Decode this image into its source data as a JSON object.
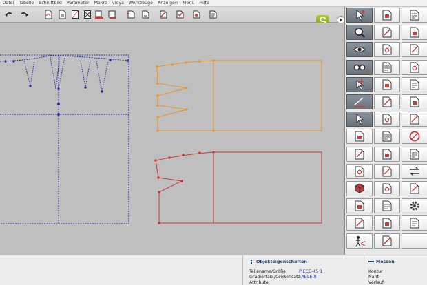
{
  "menu": [
    "Datei",
    "Tabelle",
    "Schnittbild",
    "Parameter",
    "Makro",
    "vidya",
    "Werkzeuge",
    "Anzeigen",
    "Menü",
    "Hilfe"
  ],
  "toolbar": {
    "icons": [
      "undo-icon",
      "redo-icon",
      "open-file-icon",
      "save-file-icon",
      "grade-icon",
      "cut-icon",
      "print-icon",
      "plot-icon",
      "copy-icon",
      "paste-icon",
      "measure-icon",
      "check-icon",
      "settings-icon",
      "export-icon",
      "print-preview-icon",
      "document-icon"
    ]
  },
  "tools": [
    [
      "select-arrow-icon",
      "ruler-pencil-icon",
      "piece-copy-icon"
    ],
    [
      "zoom-icon",
      "sew-icon",
      "piece-layer-icon"
    ],
    [
      "view-eye-icon",
      "piece-grade-icon",
      "piece-multi-icon"
    ],
    [
      "glasses-icon",
      "dart-icon",
      "piece-flip-icon"
    ],
    [
      "pointer-star-icon",
      "book-icon",
      "piece-split-icon"
    ],
    [
      "draw-line-icon",
      "sewing-machine-icon",
      "piece-rotate-icon"
    ],
    [
      "select-piece-icon",
      "piece-cut-icon",
      "piece-fold-icon"
    ],
    [
      "piece-delete-icon",
      "piece-edit-icon",
      "piece-circle-icon"
    ],
    [
      "piece-join-icon",
      "piece-network-icon",
      "piece-sheet-icon"
    ],
    [
      "piece-corner-icon",
      "piece-measure-icon",
      "swap-arrows-icon"
    ],
    [
      "cube-icon",
      "piece-seam-icon",
      "piece-mirror-icon"
    ],
    [
      "piece-list-icon",
      "piece-stack-icon",
      "gear-icon"
    ],
    [
      "piece-view-icon",
      "piece-pin-icon",
      "piece-pattern-icon"
    ],
    [
      "figure-icon",
      "piece-move-icon",
      "blank-tool"
    ]
  ],
  "status": {
    "objekt_header": "Objekteigenschaften",
    "teilename_label": "Teilename/Größe",
    "teilename_value": "PIECE-45 1",
    "gradiertab_label": "Gradiertab./Größensatz",
    "gradiertab_value": "TABLE00",
    "attribute_label": "Attribute",
    "messen_header": "Messen",
    "kontur_label": "Kontur",
    "naht_label": "Naht",
    "verlauf_label": "Verlauf"
  },
  "colors": {
    "accent": "#6f7880",
    "piece_blue": "#2b2f9c",
    "piece_orange": "#e6962e",
    "piece_red": "#c43c3c",
    "logo_green": "#8db21e"
  }
}
